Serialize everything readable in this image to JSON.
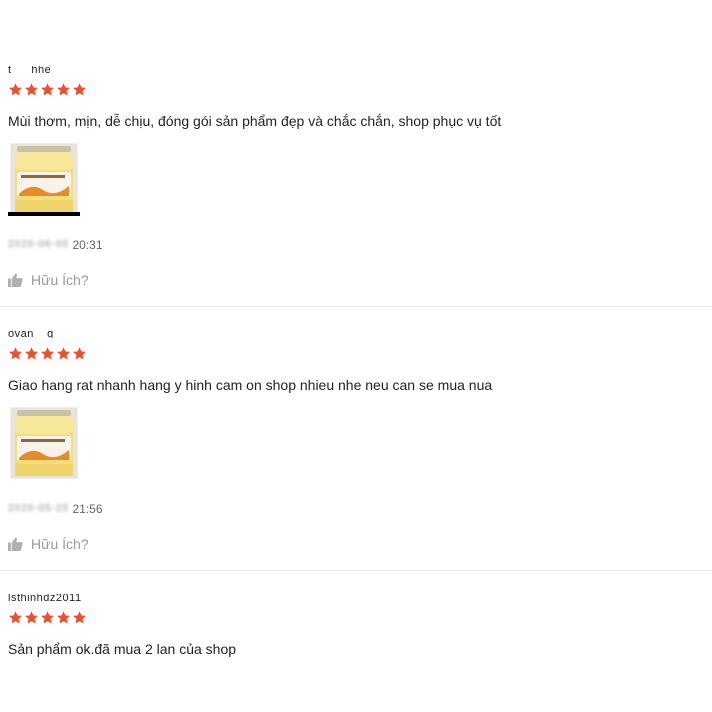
{
  "colors": {
    "star": "#ee4d2d",
    "divider": "#e6e6e6",
    "muted": "#9a9a9a"
  },
  "rating_max": 5,
  "reviews": [
    {
      "username": "t___hhe",
      "rating": 5,
      "comment": "Mùi thơm, mịn, dễ chịu, đóng gói sản phẩm đẹp và chắc chắn, shop phục vụ tốt",
      "has_image": true,
      "time_hidden": "2020-06-05",
      "time_visible": "20:31",
      "helpful_label": "Hữu Ích?"
    },
    {
      "username": "ovan__g",
      "rating": 5,
      "comment": "Giao hang rat nhanh hang y hinh cam on shop nhieu nhe neu can se mua nua",
      "has_image": true,
      "time_hidden": "2020-05-25",
      "time_visible": "21:56",
      "helpful_label": "Hữu Ích?"
    },
    {
      "username": "lsthinhdz2011_",
      "rating": 5,
      "comment": "Sản phẩm ok.đã mua 2 lan của shop",
      "has_image": false
    }
  ]
}
